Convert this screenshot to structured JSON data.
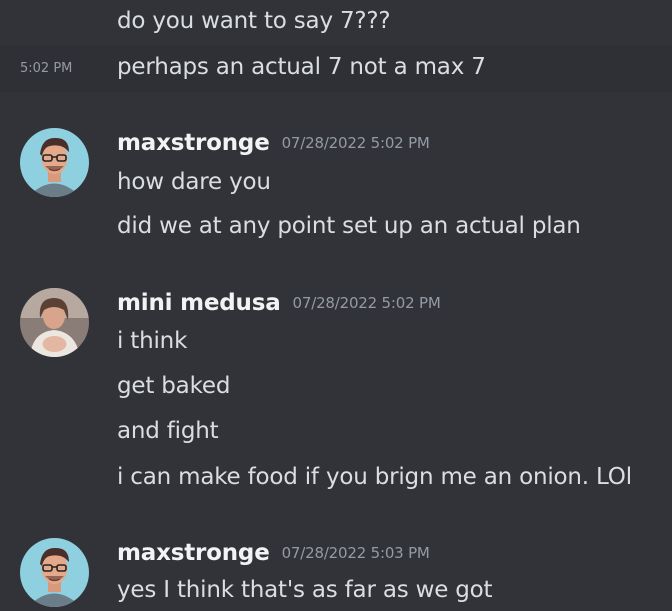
{
  "messages": {
    "m0": {
      "text": "do you want to say 7???"
    },
    "m1": {
      "time": "5:02 PM",
      "text": "perhaps an actual 7 not a max 7"
    },
    "g1": {
      "author": "maxstronge",
      "timestamp": "07/28/2022 5:02 PM",
      "lines": [
        "how dare you",
        "did we at any point set up an actual plan"
      ]
    },
    "g2": {
      "author": "mini medusa",
      "timestamp": "07/28/2022 5:02 PM",
      "lines": [
        "i think",
        "get baked",
        "and fight",
        "i can make food if you brign me an onion. LOl"
      ]
    },
    "g3": {
      "author": "maxstronge",
      "timestamp": "07/28/2022 5:03 PM",
      "lines": [
        "yes I think that's as far as we got"
      ]
    }
  }
}
